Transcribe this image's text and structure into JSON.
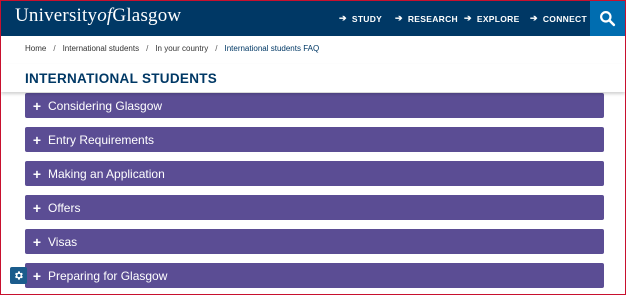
{
  "header": {
    "logo_prefix": "University",
    "logo_of": "of",
    "logo_suffix": "Glasgow",
    "nav": [
      {
        "label": "STUDY"
      },
      {
        "label": "RESEARCH"
      },
      {
        "label": "EXPLORE"
      },
      {
        "label": "CONNECT"
      }
    ],
    "nav_arrow": "➔",
    "search_icon": "search-icon"
  },
  "breadcrumb": {
    "items": [
      "Home",
      "International students",
      "In your country",
      "International students FAQ"
    ],
    "separator": "/"
  },
  "page": {
    "title": "INTERNATIONAL STUDENTS"
  },
  "accordion": {
    "plus": "+",
    "items": [
      {
        "label": "Considering Glasgow"
      },
      {
        "label": "Entry Requirements"
      },
      {
        "label": "Making an Application"
      },
      {
        "label": "Offers"
      },
      {
        "label": "Visas"
      },
      {
        "label": "Preparing for Glasgow"
      }
    ]
  },
  "colors": {
    "header_bg": "#003865",
    "search_bg": "#006db0",
    "accordion_bg": "#5b4d94",
    "title_color": "#003865"
  },
  "cookie_settings_icon": "gear-icon"
}
